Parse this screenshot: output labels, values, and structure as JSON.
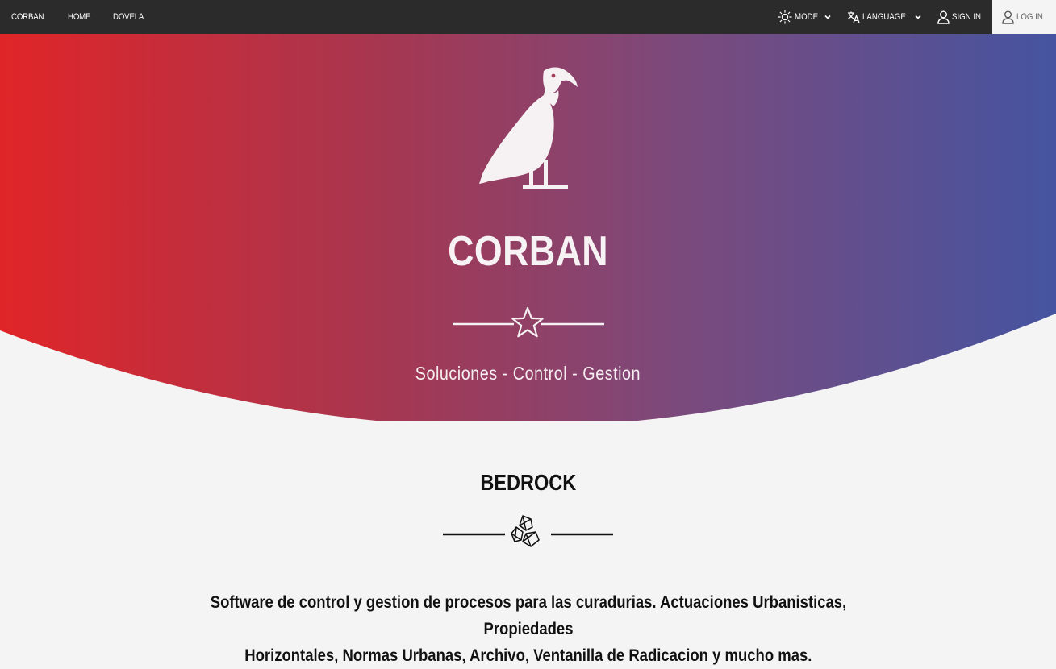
{
  "navbar": {
    "left_links": [
      "CORBAN",
      "HOME",
      "DOVELA"
    ],
    "mode_label": "MODE",
    "language_label": "LANGUAGE",
    "signin_label": "SIGN IN",
    "login_label": "LOG IN"
  },
  "hero": {
    "title": "CORBAN",
    "subtitle": "Soluciones - Control - Gestion",
    "gradient_colors": [
      "#e02528",
      "#a8364f",
      "#7a4a7d",
      "#4554a0"
    ]
  },
  "section": {
    "title": "BEDROCK",
    "description_line1": "Software de control y gestion de procesos para las curadurias. Actuaciones Urbanisticas, Propiedades",
    "description_line2": "Horizontales, Normas Urbanas, Archivo, Ventanilla de Radicacion y mucho mas."
  },
  "icons": [
    "sun-icon",
    "chevron-down-icon",
    "translate-icon",
    "user-icon",
    "vulture-logo-icon",
    "star-icon",
    "rocks-icon"
  ]
}
